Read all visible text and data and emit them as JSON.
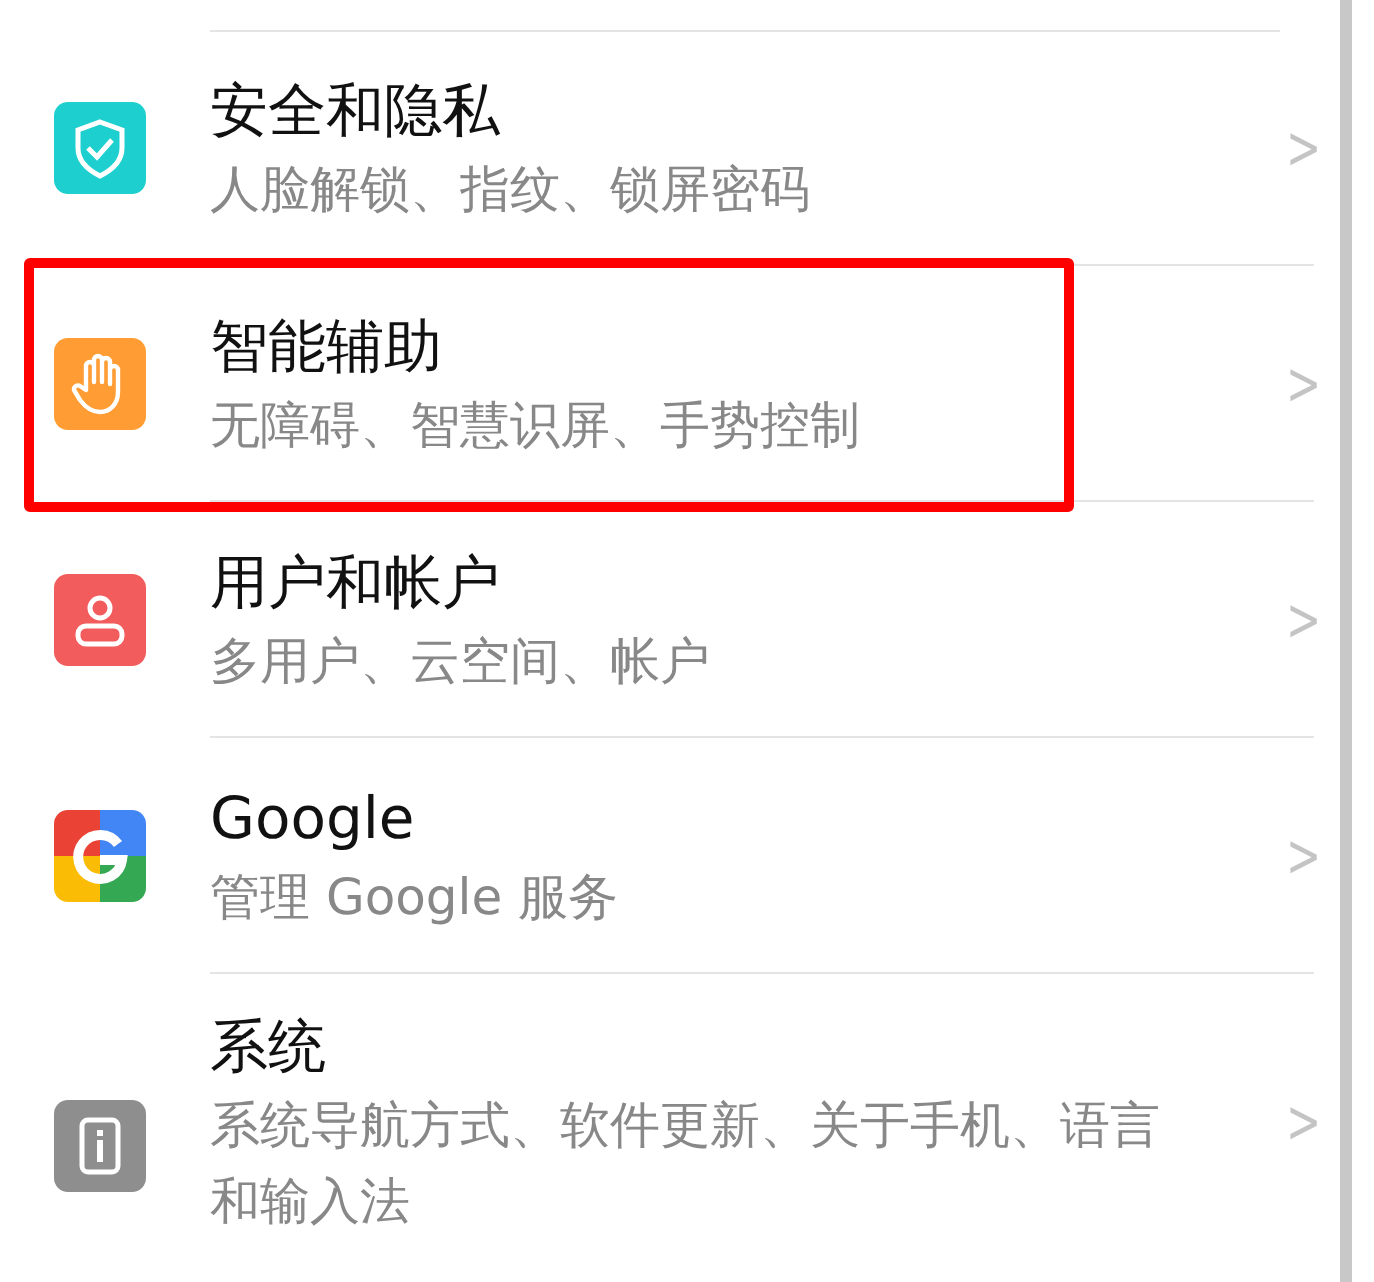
{
  "settings_items": [
    {
      "title": "安全和隐私",
      "subtitle": "人脸解锁、指纹、锁屏密码",
      "chevron": ">",
      "highlighted": false
    },
    {
      "title": "智能辅助",
      "subtitle": "无障碍、智慧识屏、手势控制",
      "chevron": ">",
      "highlighted": true
    },
    {
      "title": "用户和帐户",
      "subtitle": "多用户、云空间、帐户",
      "chevron": ">",
      "highlighted": false
    },
    {
      "title": "Google",
      "subtitle": "管理 Google 服务",
      "chevron": ">",
      "highlighted": false
    },
    {
      "title": "系统",
      "subtitle": "系统导航方式、软件更新、关于手机、语言和输入法",
      "chevron": ">",
      "highlighted": false
    }
  ]
}
